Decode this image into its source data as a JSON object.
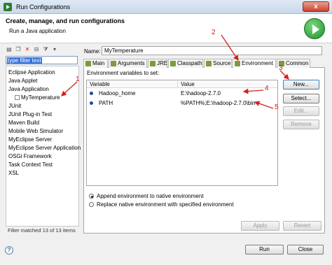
{
  "window": {
    "title": "Run Configurations",
    "close_glyph": "x"
  },
  "header": {
    "title": "Create, manage, and run configurations",
    "subtitle": "Run a Java application"
  },
  "left": {
    "toolbar_icons": [
      "new-config-icon",
      "duplicate-icon",
      "delete-icon",
      "collapse-icon",
      "filter-icon",
      "dropdown-icon"
    ],
    "filter_text": "type filter text",
    "tree": [
      {
        "label": "Eclipse Application",
        "level": 0
      },
      {
        "label": "Java Applet",
        "level": 0
      },
      {
        "label": "Java Application",
        "level": 0
      },
      {
        "label": "MyTemperature",
        "level": 1
      },
      {
        "label": "JUnit",
        "level": 0
      },
      {
        "label": "JUnit Plug-in Test",
        "level": 0
      },
      {
        "label": "Maven Build",
        "level": 0
      },
      {
        "label": "Mobile Web Simulator",
        "level": 0
      },
      {
        "label": "MyEclipse Server",
        "level": 0
      },
      {
        "label": "MyEclipse Server Application",
        "level": 0
      },
      {
        "label": "OSGi Framework",
        "level": 0
      },
      {
        "label": "Task Context Test",
        "level": 0
      },
      {
        "label": "XSL",
        "level": 0
      }
    ],
    "status": "Filter matched 13 of 13 items"
  },
  "config": {
    "name_label": "Name:",
    "name_value": "MyTemperature",
    "tabs": [
      "Main",
      "Arguments",
      "JRE",
      "Classpath",
      "Source",
      "Environment",
      "Common"
    ],
    "active_tab": "Environment",
    "env_label": "Environment variables to set:",
    "columns": [
      "Variable",
      "Value"
    ],
    "rows": [
      {
        "variable": "Hadoop_home",
        "value": "E:\\hadoop-2.7.0"
      },
      {
        "variable": "PATH",
        "value": "%PATH%;E:\\hadoop-2.7.0\\bin"
      }
    ],
    "buttons": {
      "new": "New...",
      "select": "Select...",
      "edit": "Edit...",
      "remove": "Remove"
    },
    "radio_append": "Append environment to native environment",
    "radio_replace": "Replace native environment with specified environment",
    "apply": "Apply",
    "revert": "Revert"
  },
  "footer": {
    "help": "?",
    "run": "Run",
    "close": "Close"
  },
  "annotations": [
    "1",
    "2",
    "3",
    "4",
    "5"
  ],
  "colors": {
    "annotation": "#d32020",
    "selection": "#3874d8"
  }
}
